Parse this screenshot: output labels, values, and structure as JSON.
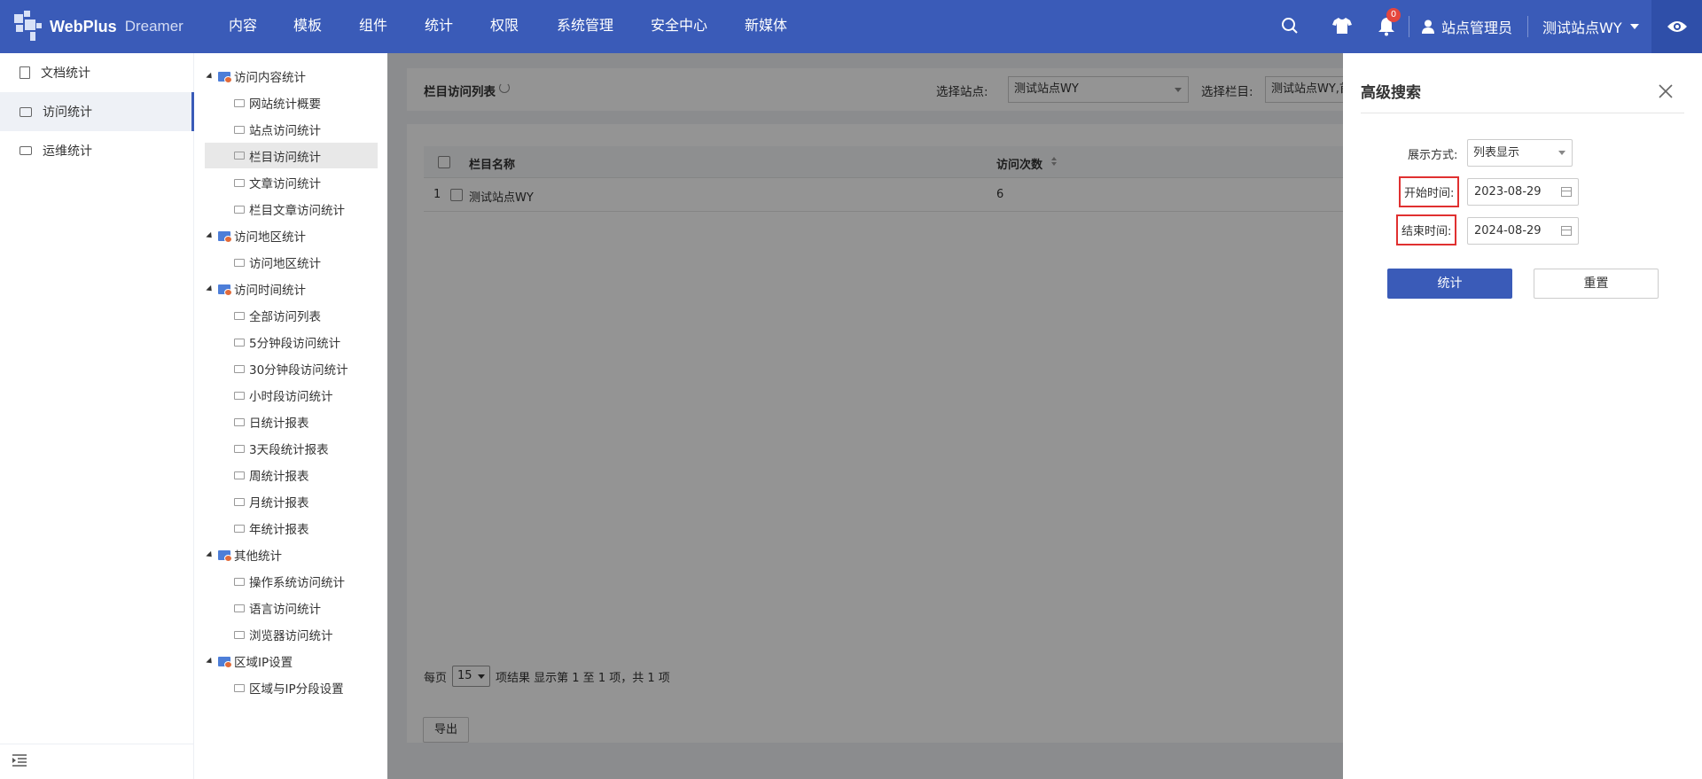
{
  "header": {
    "logo_text": "WebPlus",
    "logo_sub": "Dreamer",
    "nav": [
      "内容",
      "模板",
      "组件",
      "统计",
      "权限",
      "系统管理",
      "安全中心",
      "新媒体"
    ],
    "notification_count": "0",
    "user_label": "站点管理员",
    "site_label": "测试站点WY",
    "icons": [
      "search-icon",
      "shirt-icon",
      "bell-icon",
      "user-icon",
      "chevron-down-icon",
      "eye-icon"
    ],
    "colors": {
      "bar": "#3a5bb8",
      "eye_box": "#2f4fa9",
      "badge": "#e5463d"
    }
  },
  "sidebar": {
    "items": [
      {
        "label": "文档统计",
        "icon": "document-stats-icon"
      },
      {
        "label": "访问统计",
        "icon": "monitor-icon",
        "active": true
      },
      {
        "label": "运维统计",
        "icon": "ops-icon"
      }
    ],
    "collapse_icon": "collapse-menu-icon"
  },
  "tree": {
    "groups": [
      {
        "label": "访问内容统计",
        "children": [
          "网站统计概要",
          "站点访问统计",
          "栏目访问统计",
          "文章访问统计",
          "栏目文章访问统计"
        ]
      },
      {
        "label": "访问地区统计",
        "children": [
          "访问地区统计"
        ]
      },
      {
        "label": "访问时间统计",
        "children": [
          "全部访问列表",
          "5分钟段访问统计",
          "30分钟段访问统计",
          "小时段访问统计",
          "日统计报表",
          "3天段统计报表",
          "周统计报表",
          "月统计报表",
          "年统计报表"
        ]
      },
      {
        "label": "其他统计",
        "children": [
          "操作系统访问统计",
          "语言访问统计",
          "浏览器访问统计"
        ]
      },
      {
        "label": "区域IP设置",
        "children": [
          "区域与IP分段设置"
        ]
      }
    ],
    "selected": "栏目访问统计"
  },
  "main": {
    "list_title": "栏目访问列表",
    "site_select_label": "选择站点:",
    "site_select_value": "测试站点WY",
    "column_select_label": "选择栏目:",
    "column_select_value": "测试站点WY,首页",
    "table": {
      "columns": [
        "栏目名称",
        "访问次数"
      ],
      "rows": [
        {
          "index": "1",
          "name": "测试站点WY",
          "count": "6"
        }
      ]
    },
    "pagination": {
      "per_page_label": "每页",
      "per_page_value": "15",
      "summary": "项结果 显示第 1 至 1 项，共 1 项"
    },
    "export_label": "导出"
  },
  "panel": {
    "title": "高级搜索",
    "display_label": "展示方式:",
    "display_value": "列表显示",
    "start_label": "开始时间:",
    "start_value": "2023-08-29",
    "end_label": "结束时间:",
    "end_value": "2024-08-29",
    "submit_label": "统计",
    "reset_label": "重置",
    "highlight_color": "#e03030"
  }
}
